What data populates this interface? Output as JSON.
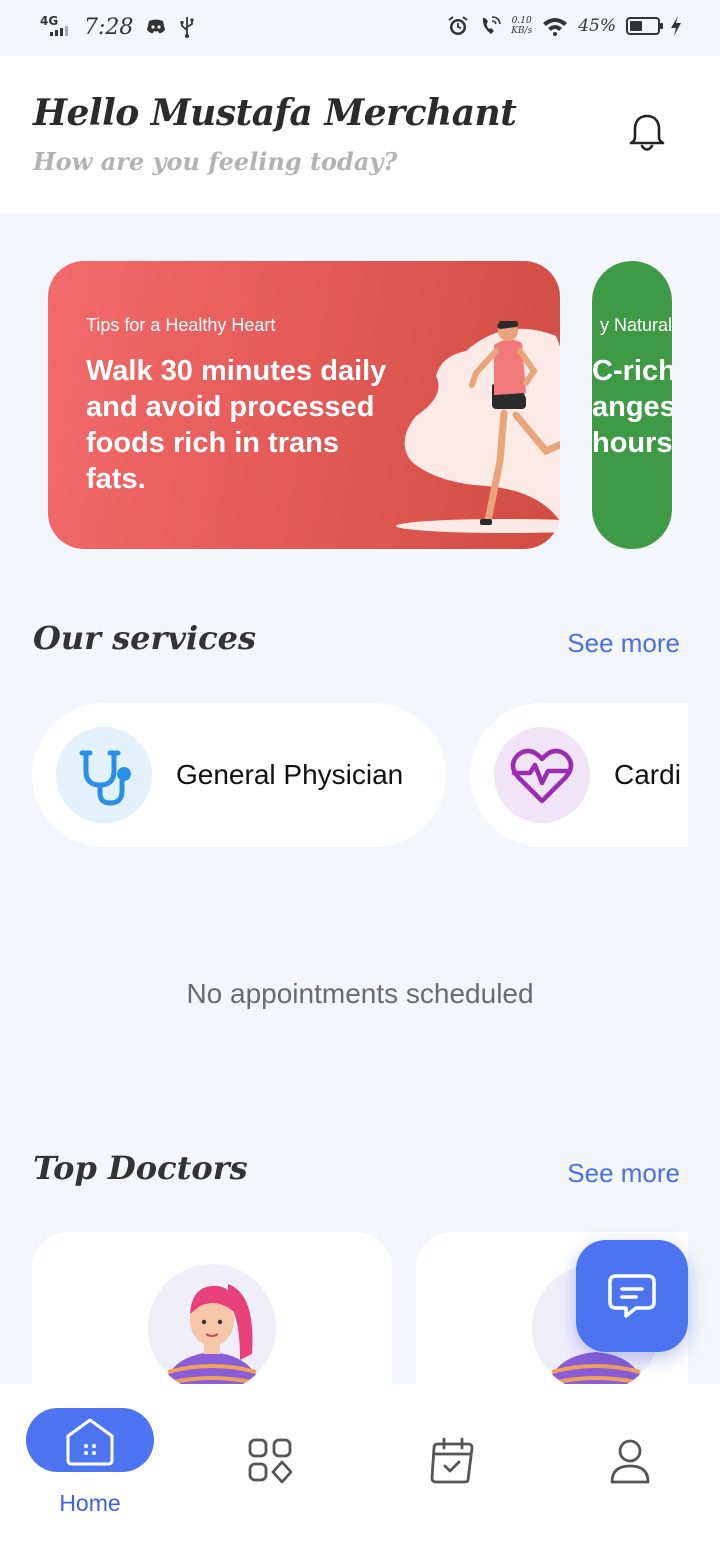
{
  "status_bar": {
    "network": "4G",
    "time": "7:28",
    "speed_value": "0.10",
    "speed_unit": "KB/s",
    "battery_percent": "45%",
    "battery_level": 0.45,
    "icons": [
      "discord-icon",
      "usb-icon",
      "alarm-icon",
      "wifi-call-icon",
      "wifi-icon",
      "charging-icon"
    ]
  },
  "header": {
    "greeting": "Hello Mustafa Merchant",
    "subtitle": "How are you feeling today?",
    "notification_icon": "bell-icon"
  },
  "tips": [
    {
      "category": "Tips for a Healthy Heart",
      "text": "Walk 30 minutes daily and avoid processed foods rich in trans fats.",
      "color": "#e35a57"
    },
    {
      "category": "y Naturall",
      "text_lines": [
        "C-rich",
        "anges",
        "hours"
      ],
      "color": "#3e9a45"
    }
  ],
  "services_section": {
    "title": "Our services",
    "see_more": "See more",
    "items": [
      {
        "label": "General Physician",
        "icon": "stethoscope-icon",
        "icon_bg": "#e3f1fd",
        "icon_color": "#2a8fe6"
      },
      {
        "label": "Cardi",
        "icon": "heart-pulse-icon",
        "icon_bg": "#f1e4f6",
        "icon_color": "#9b2bb0"
      }
    ]
  },
  "appointments": {
    "empty_message": "No appointments scheduled"
  },
  "doctors_section": {
    "title": "Top Doctors",
    "see_more": "See more"
  },
  "chat_fab": {
    "icon": "chat-icon"
  },
  "bottom_nav": {
    "active": "Home",
    "items": [
      {
        "label": "Home",
        "icon": "home-icon"
      },
      {
        "label": "",
        "icon": "categories-icon"
      },
      {
        "label": "",
        "icon": "calendar-check-icon"
      },
      {
        "label": "",
        "icon": "user-icon"
      }
    ]
  },
  "colors": {
    "accent": "#4c74f0",
    "link": "#4a6fe0",
    "background": "#f3f6fa"
  }
}
